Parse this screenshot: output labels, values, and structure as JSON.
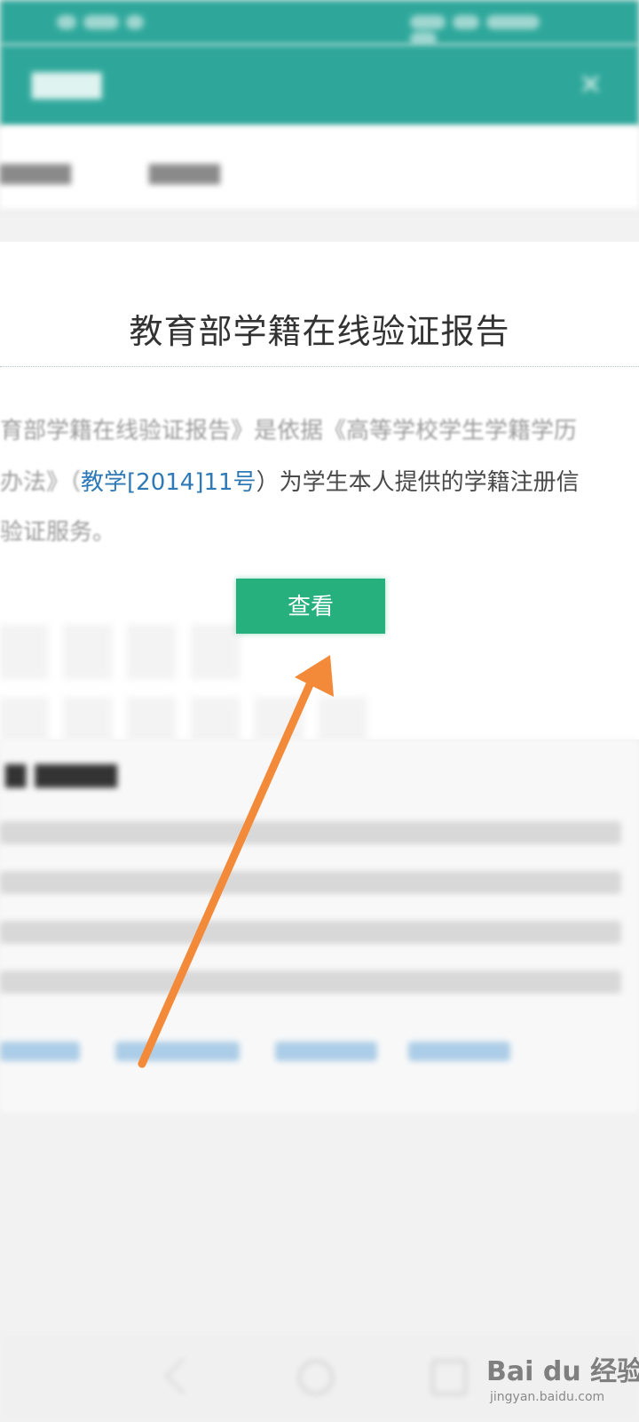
{
  "card": {
    "title": "教育部学籍在线验证报告",
    "line1": "育部学籍在线验证报告》是依据《高等学校学生学籍学历",
    "line2_pre": "办法》（",
    "line2_link": "教学[2014]11号",
    "line2_post": "）为学生本人提供的学籍注册信",
    "line3": "验证服务。",
    "view_button": "查看"
  },
  "icons": {
    "close": "close-icon",
    "arrow": "orange-arrow-annotation",
    "nav": [
      "back-icon",
      "home-icon",
      "recents-icon"
    ]
  },
  "watermark": {
    "main": "Bai du 经验",
    "sub": "jingyan.baidu.com"
  },
  "colors": {
    "header": "#2ea79a",
    "button": "#26b07d",
    "link": "#2f7ab6",
    "arrow": "#f28a3a"
  }
}
